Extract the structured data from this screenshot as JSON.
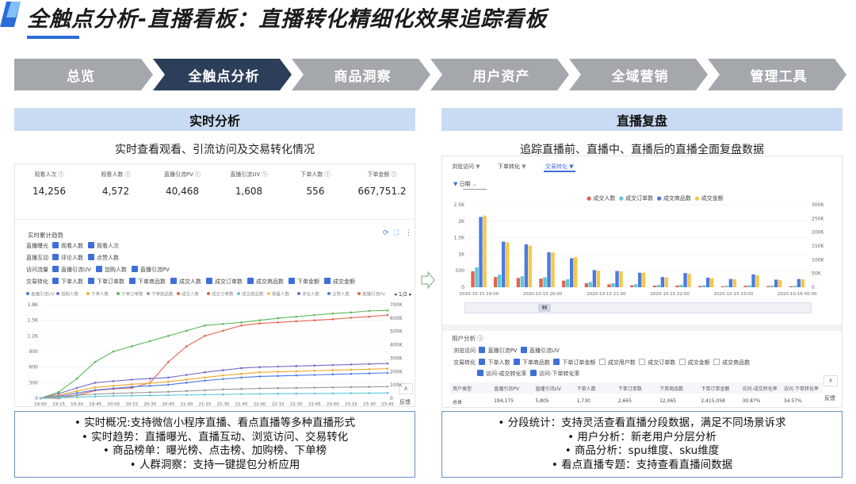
{
  "page": {
    "title": "全触点分析-直播看板：直播转化精细化效果追踪看板"
  },
  "nav": [
    {
      "label": "总览",
      "active": false
    },
    {
      "label": "全触点分析",
      "active": true
    },
    {
      "label": "商品洞察",
      "active": false
    },
    {
      "label": "用户资产",
      "active": false
    },
    {
      "label": "全域营销",
      "active": false
    },
    {
      "label": "管理工具",
      "active": false
    }
  ],
  "colors": {
    "accent": "#2d6bd8",
    "nav_active": "#2c3e5a",
    "nav_inactive": "#a4a7ac",
    "panel_head": "#c9dbf3",
    "bullet_border": "#6c8fbf"
  },
  "left": {
    "header": "实时分析",
    "subtitle": "实时查看观看、引流访问及交易转化情况",
    "metrics": [
      {
        "label": "观看人次",
        "value": "14,256"
      },
      {
        "label": "观看人数",
        "value": "4,572"
      },
      {
        "label": "直播引流PV",
        "value": "40,468"
      },
      {
        "label": "直播引流UV",
        "value": "1,608"
      },
      {
        "label": "下单人数",
        "value": "556"
      },
      {
        "label": "下单金额",
        "value": "667,751.2"
      }
    ],
    "trend_title": "实时累计趋势",
    "filters": [
      {
        "group": "直播曝光",
        "items": [
          "观看人数",
          "观看人次"
        ]
      },
      {
        "group": "直播互动",
        "items": [
          "评论人数",
          "点赞人数"
        ]
      },
      {
        "group": "访问流量",
        "items": [
          "直播引流UV",
          "加购人数",
          "直播引流PV"
        ]
      },
      {
        "group": "交易转化",
        "items": [
          "下单人数",
          "下单订单数",
          "下单商品数",
          "成交人数",
          "成交订单数",
          "成交商品数",
          "下单金额",
          "成交金额"
        ]
      }
    ],
    "legend_page": "1/2",
    "feedback": "反馈",
    "bullets": [
      "• 实时概况:支持微信小程序直播、看点直播等多种直播形式",
      "• 实时趋势：直播曝光、直播互动、浏览访问、交易转化",
      "• 商品榜单：曝光榜、点击榜、加购榜、下单榜",
      "• 人群洞察：支持一键提包分析应用"
    ]
  },
  "right": {
    "header": "直播复盘",
    "subtitle": "追踪直播前、直播中、直播后的直播全面复盘数据",
    "tabs": [
      "浏览访问",
      "下单转化",
      "交易转化"
    ],
    "date_selector": "日期",
    "legend": [
      "成交人数",
      "成交订单数",
      "成交商品数",
      "成交金额"
    ],
    "user_section_title": "用户分析",
    "row1_group": "浏览访问",
    "row1_items": [
      "直播引流PV",
      "直播引流UV"
    ],
    "row2_group": "交易转化",
    "row2_items": [
      {
        "label": "下单人数",
        "on": true
      },
      {
        "label": "下单商品数",
        "on": true
      },
      {
        "label": "下单订单金额",
        "on": true
      },
      {
        "label": "成交用户数",
        "on": false
      },
      {
        "label": "成交订单数",
        "on": false
      },
      {
        "label": "成交金额",
        "on": false
      },
      {
        "label": "成交商品数",
        "on": false
      }
    ],
    "row3_items": [
      "访问-成交转化率",
      "访问-下单转化率"
    ],
    "table_headers": [
      "用户类型",
      "直播引流PV",
      "直播引流UV",
      "下单人数",
      "下单订单数",
      "下单商品数",
      "下单订单金额",
      "访问-成交转化率",
      "访问-下单转化率"
    ],
    "table_row": [
      "总体",
      "194,175",
      "5,805",
      "1,730",
      "2,665",
      "12,065",
      "2,415,058",
      "30.87%",
      "34.57%"
    ],
    "feedback": "反馈",
    "bullets": [
      "• 分段统计：支持灵活查看直播分段数据，满足不同场景诉求",
      "• 用户分析：新老用户分层分析",
      "• 商品分析：spu维度、sku维度",
      "• 看点直播专题：支持查看直播间数据"
    ]
  },
  "chart_data": [
    {
      "type": "line",
      "title": "实时累计趋势",
      "x": [
        "19:00",
        "19:15",
        "19:30",
        "19:45",
        "20:00",
        "20:15",
        "20:30",
        "20:45",
        "21:00",
        "21:15",
        "21:30",
        "21:45",
        "22:00",
        "22:15",
        "22:30",
        "22:45",
        "23:00",
        "23:15",
        "23:30",
        "23:45"
      ],
      "ylim": [
        0,
        1800
      ],
      "y_ticks": [
        "0",
        "300",
        "600",
        "900",
        "1.2K",
        "1.5K",
        "1.8K"
      ],
      "y2lim": [
        0,
        700000
      ],
      "y2_ticks": [
        "0",
        "100K",
        "200K",
        "300K",
        "400K",
        "500K",
        "600K",
        "700K"
      ],
      "legend": [
        "直播引流UV",
        "加购人数",
        "下单人数",
        "下单订单数",
        "下单商品数",
        "成交人数",
        "成交订单数",
        "成交商品数",
        "观看人数",
        "评论人数",
        "点赞人数",
        "直播引流PV"
      ],
      "series": [
        {
          "name": "下单订单数",
          "color": "#5cb85c",
          "values": [
            0,
            120,
            380,
            700,
            900,
            1000,
            1100,
            1200,
            1300,
            1400,
            1430,
            1460,
            1500,
            1540,
            1570,
            1600,
            1630,
            1650,
            1680,
            1690
          ]
        },
        {
          "name": "成交订单数",
          "color": "#e26452",
          "values": [
            0,
            0,
            60,
            150,
            180,
            200,
            300,
            700,
            1000,
            1200,
            1300,
            1400,
            1440,
            1460,
            1480,
            1500,
            1520,
            1550,
            1570,
            1600
          ]
        },
        {
          "name": "下单人数",
          "color": "#7b68c8",
          "values": [
            0,
            90,
            200,
            300,
            330,
            360,
            380,
            400,
            450,
            500,
            540,
            580,
            600,
            610,
            620,
            630,
            640,
            650,
            660,
            670
          ]
        },
        {
          "name": "加购人数",
          "color": "#f0a830",
          "values": [
            0,
            60,
            140,
            210,
            240,
            270,
            290,
            320,
            360,
            400,
            440,
            470,
            500,
            510,
            520,
            530,
            540,
            550,
            560,
            570
          ]
        },
        {
          "name": "直播引流UV",
          "color": "#4b7be0",
          "values": [
            0,
            40,
            100,
            160,
            190,
            220,
            240,
            260,
            300,
            340,
            370,
            400,
            420,
            430,
            440,
            450,
            460,
            470,
            480,
            490
          ]
        },
        {
          "name": "下单商品数",
          "color": "#999999",
          "values": [
            0,
            30,
            60,
            80,
            95,
            105,
            115,
            125,
            140,
            155,
            170,
            180,
            190,
            195,
            200,
            205,
            210,
            215,
            220,
            225
          ]
        },
        {
          "name": "观看人数",
          "color": "#5fc9d8",
          "values": [
            0,
            10,
            25,
            35,
            45,
            50,
            55,
            60,
            65,
            70,
            75,
            80,
            85,
            88,
            90,
            92,
            95,
            98,
            100,
            102
          ]
        }
      ]
    },
    {
      "type": "bar",
      "categories": [
        "2020-10-15 19:00",
        "19:20",
        "19:40",
        "2020-10-15 20:00",
        "20:20",
        "20:40",
        "2020-10-15 21:00",
        "21:20",
        "21:40",
        "2020-10-15 22:00",
        "22:20",
        "22:40",
        "2020-10-15 23:00",
        "23:20",
        "23:40",
        "2020-10-16 00:00"
      ],
      "x_tick_labels": [
        "2020-10-15 19:00",
        "2020-10-15 20:00",
        "2020-10-15 21:00",
        "2020-10-15 22:00",
        "2020-10-15 23:00",
        "2020-10-16 00:00"
      ],
      "ylim": [
        0,
        2500
      ],
      "y_ticks": [
        "0",
        "500",
        "1K",
        "1.5K",
        "2K",
        "2.5K"
      ],
      "y2lim": [
        0,
        300000
      ],
      "y2_ticks": [
        "0",
        "50K",
        "100K",
        "150K",
        "200K",
        "250K",
        "300K"
      ],
      "series": [
        {
          "name": "成交人数",
          "color": "#e26452",
          "values": [
            480,
            310,
            280,
            260,
            200,
            120,
            90,
            60,
            50,
            55,
            40,
            30,
            45,
            35,
            30
          ]
        },
        {
          "name": "成交订单数",
          "color": "#5fc9d8",
          "values": [
            600,
            380,
            330,
            300,
            240,
            160,
            120,
            90,
            70,
            75,
            60,
            45,
            60,
            50,
            45
          ]
        },
        {
          "name": "成交商品数",
          "color": "#4b7be0",
          "values": [
            2130,
            1380,
            1300,
            1060,
            880,
            520,
            490,
            440,
            310,
            430,
            290,
            250,
            390,
            230,
            250
          ]
        },
        {
          "name": "成交金额",
          "color": "#f6c84a",
          "values": [
            2170,
            1360,
            1260,
            1050,
            910,
            500,
            480,
            440,
            300,
            410,
            270,
            240,
            360,
            220,
            240
          ]
        }
      ]
    }
  ]
}
